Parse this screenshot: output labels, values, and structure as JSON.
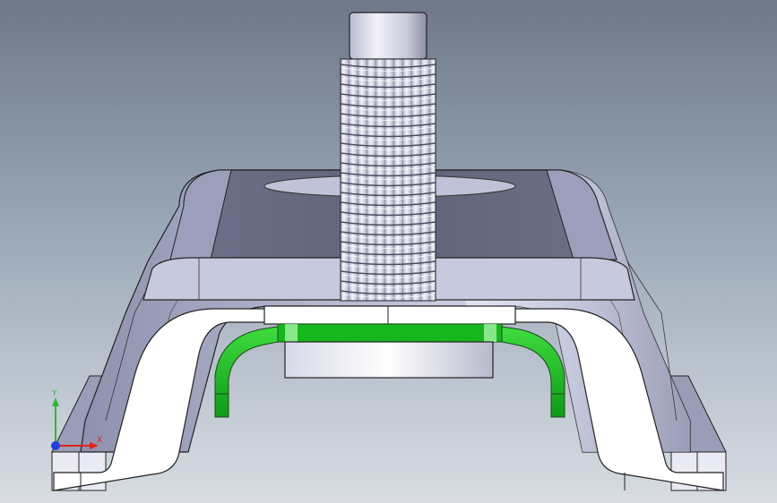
{
  "viewport": {
    "background_top": "#6e7889",
    "background_bottom": "#d8dde3"
  },
  "colors": {
    "clip_top": "#5f6479",
    "clip_side": "#a9adc6",
    "clip_light": "#e9eaf4",
    "section_face": "#ffffff",
    "spring_green": "#14b51e",
    "bolt_light": "#f2f2f8",
    "bolt_shadow": "#8d8fa4"
  },
  "triad": {
    "x_label": "X",
    "y_label": "Y",
    "x_color": "#e2231a",
    "y_color": "#2eb82e",
    "z_color": "#1f3fd8"
  }
}
